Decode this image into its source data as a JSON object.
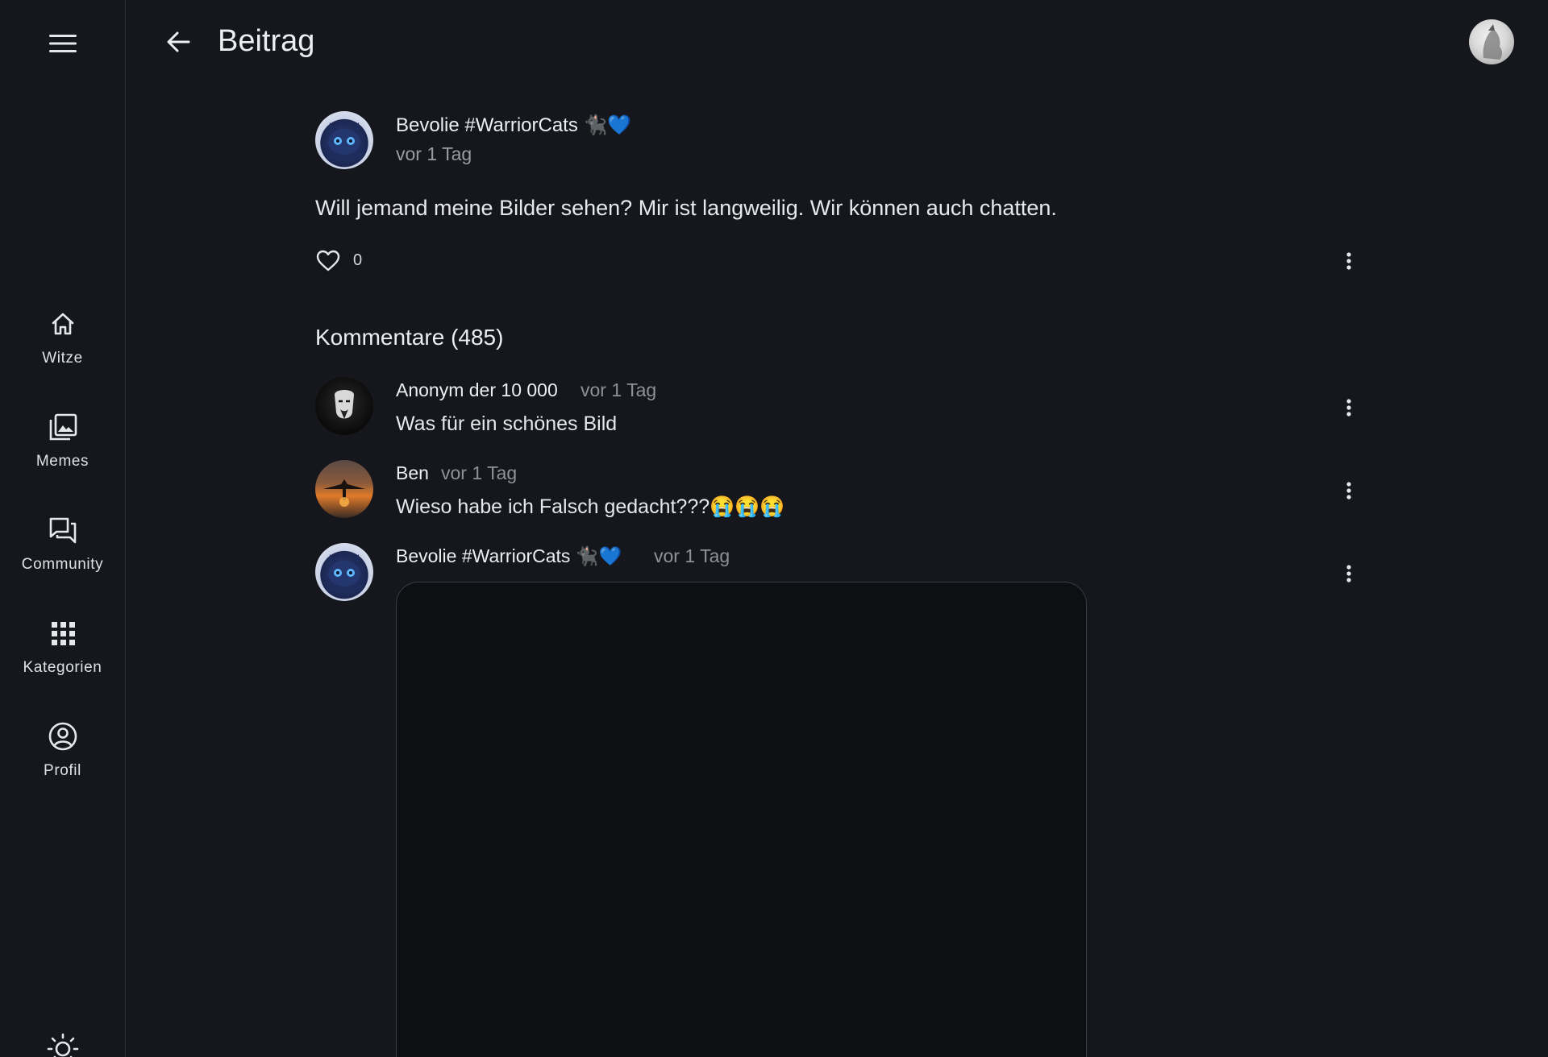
{
  "sidebar": {
    "items": [
      {
        "label": "Witze",
        "icon": "home-icon"
      },
      {
        "label": "Memes",
        "icon": "image-gallery-icon"
      },
      {
        "label": "Community",
        "icon": "forum-icon"
      },
      {
        "label": "Kategorien",
        "icon": "grid-icon"
      },
      {
        "label": "Profil",
        "icon": "account-circle-icon"
      }
    ]
  },
  "header": {
    "title": "Beitrag"
  },
  "post": {
    "author": "Bevolie #WarriorCats 🐈‍⬛💙",
    "time": "vor 1 Tag",
    "text": "Will jemand meine Bilder sehen? Mir ist langweilig. Wir können auch chatten.",
    "likes": "0"
  },
  "comments_section": {
    "title": "Kommentare (485)",
    "comments": [
      {
        "author": "Anonym der 10 000",
        "time": "vor 1 Tag",
        "text": "Was für ein schönes Bild"
      },
      {
        "author": "Ben",
        "time": "vor 1 Tag",
        "text": "Wieso habe ich Falsch gedacht???😭😭😭"
      },
      {
        "author": "Bevolie #WarriorCats 🐈‍⬛💙",
        "time": "vor 1 Tag",
        "text": ""
      }
    ]
  },
  "colors": {
    "background": "#15171c",
    "text": "#e6e7ea",
    "muted": "#8f9199",
    "divider": "#2b2e35"
  }
}
